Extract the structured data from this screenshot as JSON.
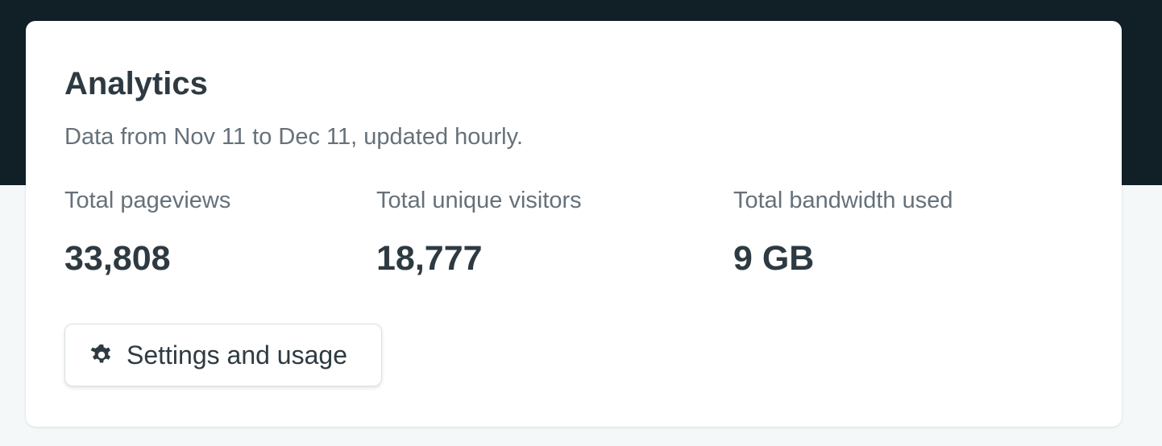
{
  "analytics": {
    "title": "Analytics",
    "subtitle": "Data from Nov 11 to Dec 11, updated hourly.",
    "stats": [
      {
        "label": "Total pageviews",
        "value": "33,808"
      },
      {
        "label": "Total unique visitors",
        "value": "18,777"
      },
      {
        "label": "Total bandwidth used",
        "value": "9 GB"
      }
    ],
    "settings_button": {
      "icon": "gear-icon",
      "label": "Settings and usage"
    }
  },
  "colors": {
    "header_background": "#111f27",
    "page_background": "#f5f8f9",
    "card_background": "#ffffff",
    "heading_text": "#2e3a41",
    "muted_text": "#65717a"
  }
}
